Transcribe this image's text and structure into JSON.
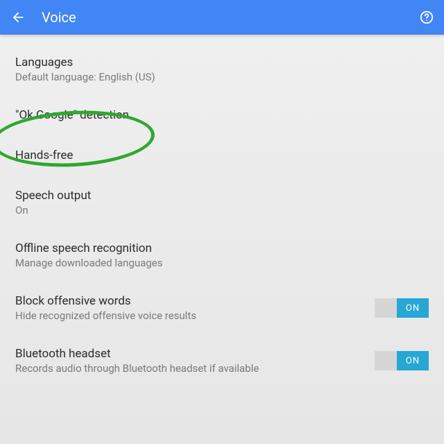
{
  "header": {
    "title": "Voice",
    "back_icon": "back-arrow",
    "help_icon": "help"
  },
  "settings": {
    "languages": {
      "title": "Languages",
      "subtitle": "Default language: English (US)"
    },
    "ok_google": {
      "title": "\"Ok Google\" detection"
    },
    "hands_free": {
      "title": "Hands-free"
    },
    "speech_output": {
      "title": "Speech output",
      "subtitle": "On"
    },
    "offline": {
      "title": "Offline speech recognition",
      "subtitle": "Manage downloaded languages"
    },
    "block_offensive": {
      "title": "Block offensive words",
      "subtitle": "Hide recognized offensive voice results",
      "switch": "ON"
    },
    "bluetooth": {
      "title": "Bluetooth headset",
      "subtitle": "Records audio through Bluetooth headset if available",
      "switch": "ON"
    }
  },
  "annotation": {
    "highlight": "ok_google",
    "color": "#2fa82f"
  }
}
